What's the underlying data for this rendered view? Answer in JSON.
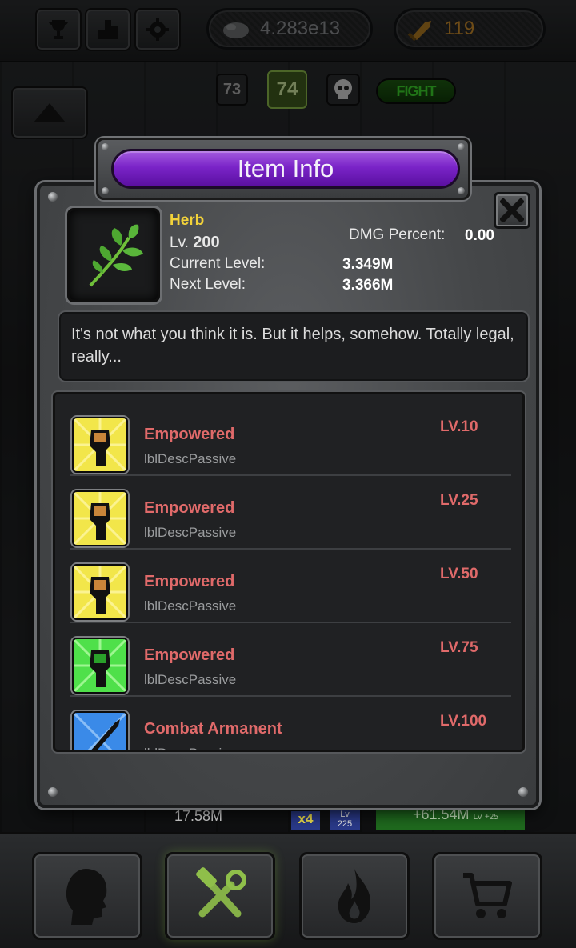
{
  "topbar": {
    "trophy_icon": "trophy-icon",
    "leaderboard_icon": "podium-icon",
    "settings_icon": "gear-icon",
    "gold_value": "4.283e13",
    "gems_value": "119"
  },
  "stage": {
    "prev": "73",
    "current": "74",
    "boss_icon": "skull-icon",
    "fight_label": "FIGHT"
  },
  "dialog": {
    "title": "Item Info",
    "item": {
      "name": "Herb",
      "lv_label": "Lv.",
      "lv_value": "200",
      "dmg_label": "DMG Percent:",
      "dmg_value": "0.00",
      "current_label": "Current Level:",
      "current_value": "3.349M",
      "next_label": "Next Level:",
      "next_value": "3.366M",
      "description": "It's not what you think it is. But it helps, somehow. Totally legal, really..."
    },
    "skills": [
      {
        "name": "Empowered",
        "desc": "lblDescPassive",
        "level": "LV.10",
        "icon": "fist-icon",
        "color": "#f2e64a"
      },
      {
        "name": "Empowered",
        "desc": "lblDescPassive",
        "level": "LV.25",
        "icon": "fist-icon",
        "color": "#f2e64a"
      },
      {
        "name": "Empowered",
        "desc": "lblDescPassive",
        "level": "LV.50",
        "icon": "fist-icon",
        "color": "#f2e64a"
      },
      {
        "name": "Empowered",
        "desc": "lblDescPassive",
        "level": "LV.75",
        "icon": "fist-icon",
        "color": "#4fe04a"
      },
      {
        "name": "Combat Armanent",
        "desc": "lblDescPassive",
        "level": "LV.100",
        "icon": "sword-icon",
        "color": "#3a8ae8"
      }
    ]
  },
  "peek": {
    "dps_left": "17.58M",
    "multiplier": "x4",
    "lv_badge": "Lv",
    "lv_badge_num": "225",
    "gain": "+61.54M",
    "gain_lv": "LV +25"
  },
  "bottombar": {
    "heroes_icon": "head-icon",
    "upgrade_icon": "tools-icon",
    "skills_icon": "fire-icon",
    "shop_icon": "cart-icon"
  }
}
